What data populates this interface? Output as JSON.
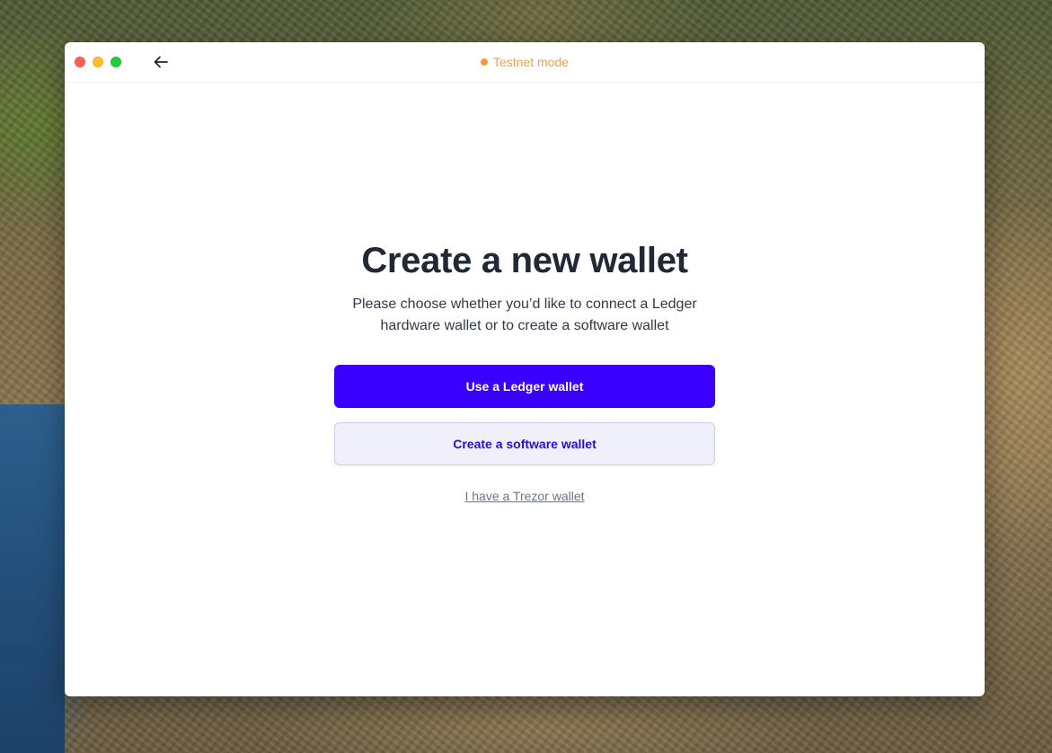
{
  "titlebar": {
    "back_icon": "arrow-left-icon",
    "status_label": "Testnet mode",
    "status_color": "#f39a3d"
  },
  "main": {
    "heading": "Create a new wallet",
    "subtitle": "Please choose whether you’d like to connect a Ledger hardware wallet or to create a software wallet",
    "primary_button_label": "Use a Ledger wallet",
    "secondary_button_label": "Create a software wallet",
    "trezor_link_label": "I have a Trezor wallet"
  },
  "colors": {
    "primary": "#3a00ff",
    "secondary_bg": "#eff0fb",
    "heading": "#222836",
    "testnet": "#f39a3d"
  }
}
